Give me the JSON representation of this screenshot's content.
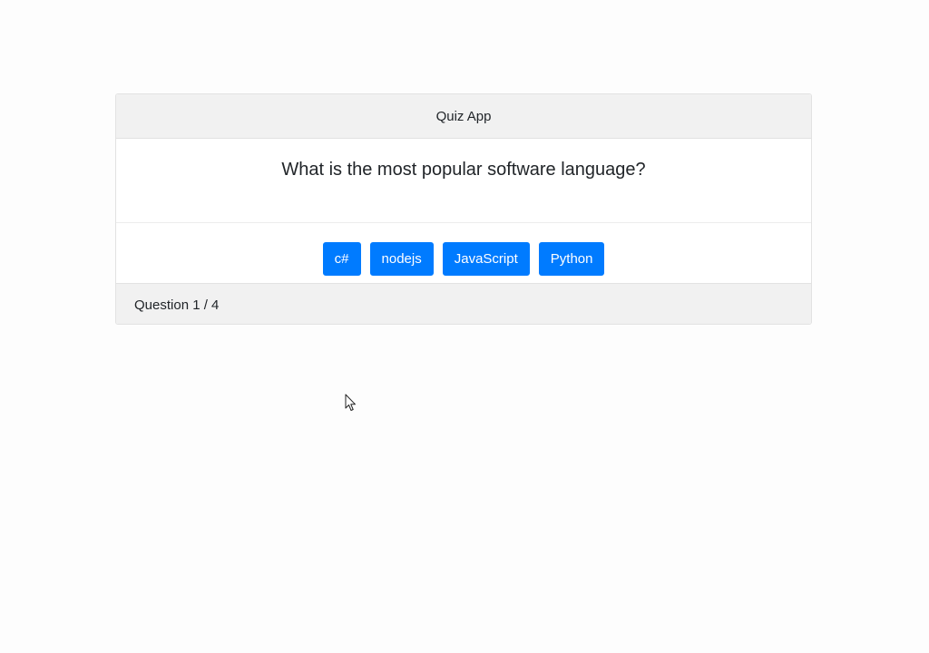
{
  "header": {
    "title": "Quiz App"
  },
  "question": {
    "text": "What is the most popular software language?"
  },
  "answers": [
    {
      "label": "c#"
    },
    {
      "label": "nodejs"
    },
    {
      "label": "JavaScript"
    },
    {
      "label": "Python"
    }
  ],
  "footer": {
    "progress": "Question 1 / 4"
  },
  "colors": {
    "accent": "#007bff",
    "header_bg": "#f1f1f1"
  },
  "icons": {
    "cursor": "mouse-pointer-icon"
  }
}
